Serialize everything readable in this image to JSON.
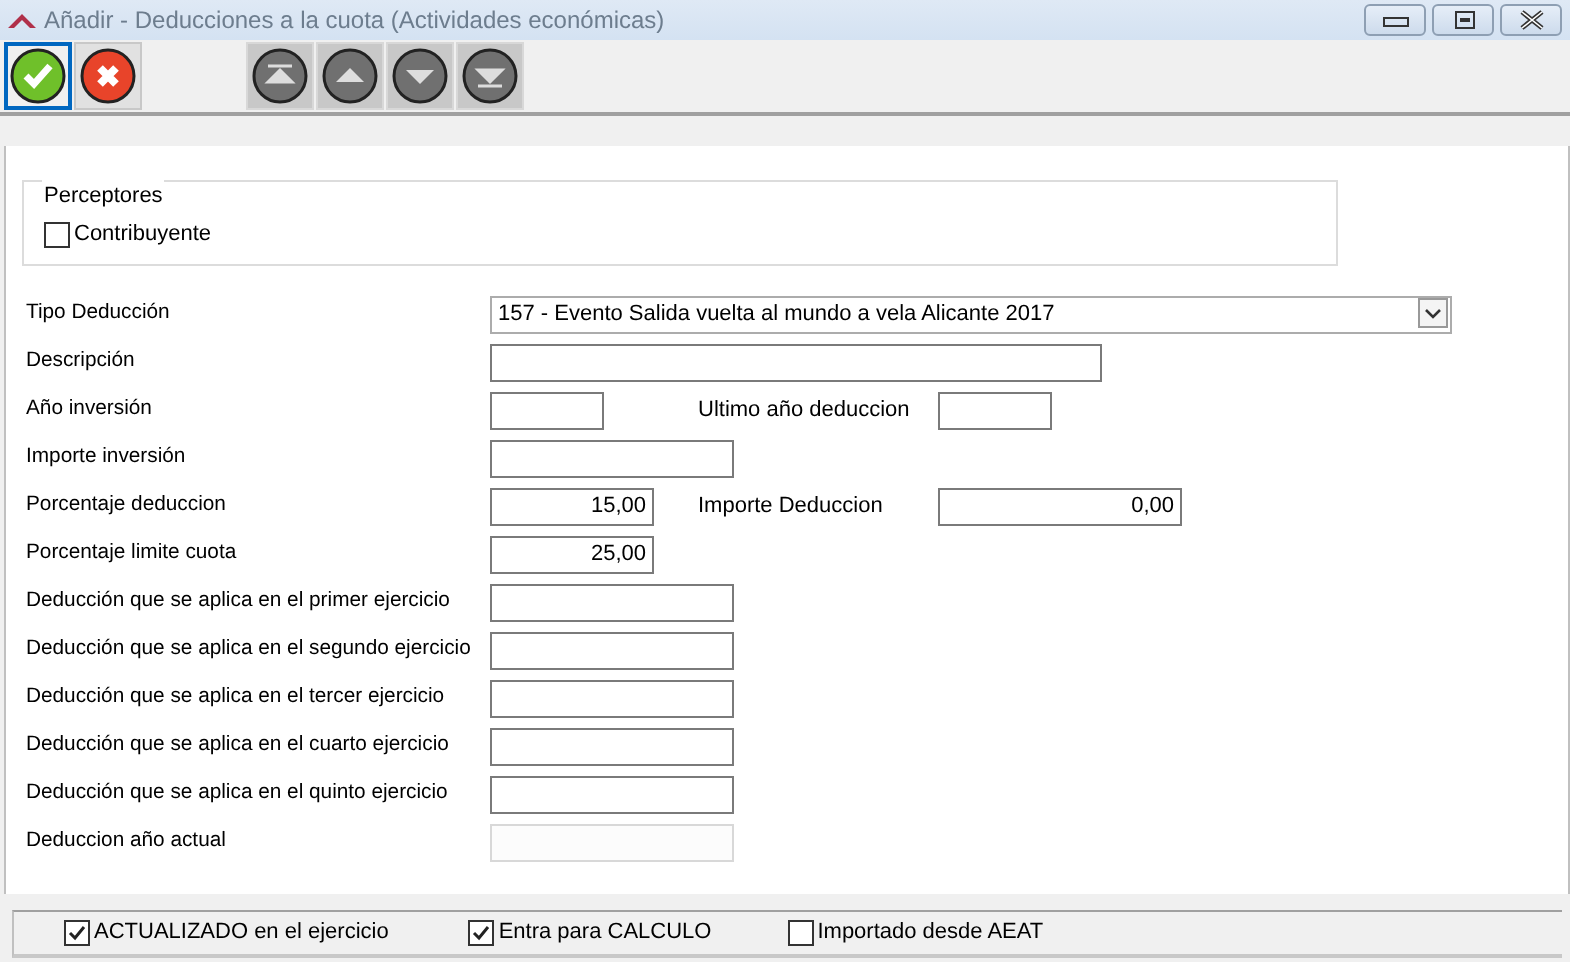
{
  "window": {
    "title": "Añadir  - Deducciones a la cuota (Actividades económicas)"
  },
  "toolbar": [
    {
      "kind": "accept",
      "selected": true
    },
    {
      "kind": "cancel",
      "selected": false
    },
    {
      "kind": "first",
      "selected": false
    },
    {
      "kind": "up",
      "selected": false
    },
    {
      "kind": "down",
      "selected": false
    },
    {
      "kind": "last",
      "selected": false
    }
  ],
  "perceptores": {
    "title": "Perceptores",
    "options": [
      {
        "label": "Contribuyente",
        "checked": false
      }
    ]
  },
  "form": [
    {
      "label": "Tipo Deducción",
      "field": {
        "kind": "select",
        "value": "157 - Evento Salida vuelta al mundo a vela Alicante 2017"
      }
    },
    {
      "label": "Descripción",
      "field": {
        "kind": "text"
      }
    },
    {
      "label": "Año inversión",
      "field": {
        "kind": "text"
      },
      "side": {
        "label": "Ultimo año deduccion",
        "field": {
          "kind": "text"
        }
      }
    },
    {
      "label": "Importe inversión",
      "field": {
        "kind": "text"
      }
    },
    {
      "label": "Porcentaje deduccion",
      "field": {
        "kind": "number",
        "value": "15,00"
      },
      "side": {
        "label": "Importe Deduccion",
        "field": {
          "kind": "number",
          "value": "0,00"
        }
      }
    },
    {
      "label": "Porcentaje limite cuota",
      "field": {
        "kind": "number",
        "value": "25,00"
      }
    },
    {
      "label": "Deducción que se aplica en el primer ejercicio",
      "field": {
        "kind": "text"
      }
    },
    {
      "label": "Deducción que se aplica en el segundo ejercicio",
      "field": {
        "kind": "text"
      }
    },
    {
      "label": "Deducción que se aplica en el tercer ejercicio",
      "field": {
        "kind": "text"
      }
    },
    {
      "label": "Deducción que se aplica en el cuarto ejercicio",
      "field": {
        "kind": "text"
      }
    },
    {
      "label": "Deducción que se aplica en el quinto ejercicio",
      "field": {
        "kind": "text"
      }
    },
    {
      "label": "Deduccion año actual",
      "field": {
        "kind": "text",
        "disabled": true
      }
    }
  ],
  "footer": [
    {
      "label": "ACTUALIZADO en el ejercicio",
      "checked": true
    },
    {
      "label": "Entra para CALCULO",
      "checked": true
    },
    {
      "label": "Importado desde AEAT",
      "checked": false
    }
  ]
}
